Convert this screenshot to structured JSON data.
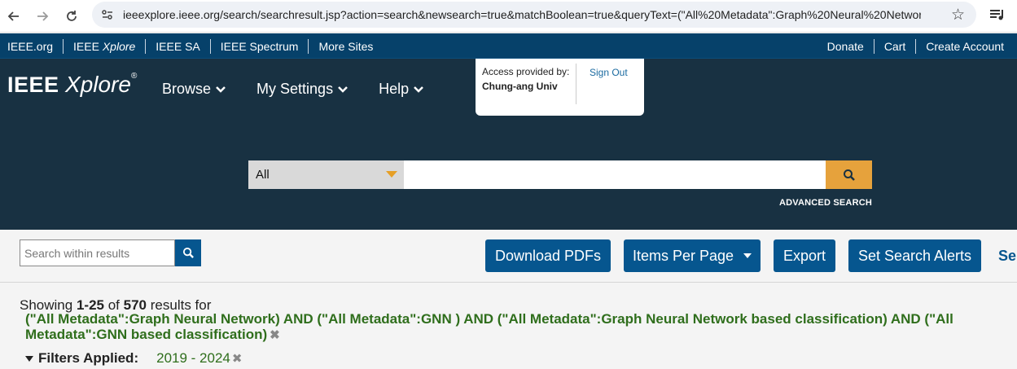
{
  "browser": {
    "url": "ieeexplore.ieee.org/search/searchresult.jsp?action=search&newsearch=true&matchBoolean=true&queryText=(\"All%20Metadata\":Graph%20Neural%20Network)..."
  },
  "topbar": {
    "left": [
      "IEEE.org",
      "IEEE Xplore",
      "IEEE SA",
      "IEEE Spectrum",
      "More Sites"
    ],
    "right": [
      "Donate",
      "Cart",
      "Create Account"
    ]
  },
  "header": {
    "logo_ieee": "IEEE",
    "logo_xplore": "Xplore",
    "logo_reg": "®",
    "nav": [
      "Browse",
      "My Settings",
      "Help"
    ],
    "access_label": "Access provided by:",
    "institution": "Chung-ang Univ",
    "sign_out": "Sign Out",
    "search_category": "All",
    "search_value": "",
    "advanced_search": "ADVANCED SEARCH"
  },
  "toolbar": {
    "within_placeholder": "Search within results",
    "download_pdfs": "Download PDFs",
    "items_per_page": "Items Per Page",
    "export": "Export",
    "set_search_alerts": "Set Search Alerts",
    "cutoff_text": "Se"
  },
  "results": {
    "showing_prefix": "Showing",
    "range": "1-25",
    "of": "of",
    "total": "570",
    "results_for": "results for",
    "query": "(\"All Metadata\":Graph Neural Network) AND (\"All Metadata\":GNN ) AND (\"All Metadata\":Graph Neural Network based classification) AND (\"All Metadata\":GNN based classification)",
    "filters_title": "Filters Applied:",
    "filter_value": "2019 - 2024"
  },
  "colors": {
    "topbar": "#06416a",
    "header": "#183142",
    "button": "#06568f",
    "search_go": "#e6a23c",
    "query_green": "#2f6e1c"
  }
}
